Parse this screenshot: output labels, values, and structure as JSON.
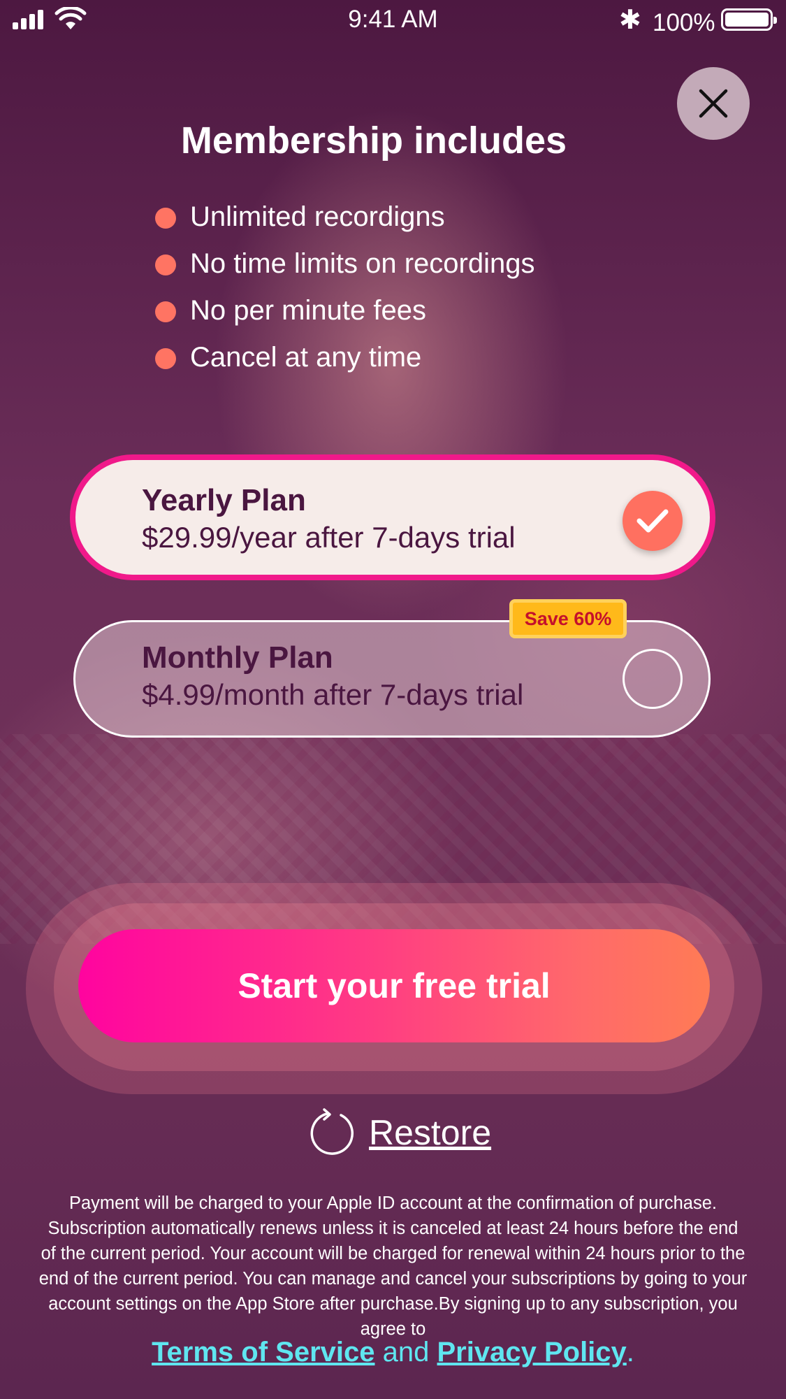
{
  "status_bar": {
    "time": "9:41 AM",
    "battery_pct": "100%"
  },
  "header": {
    "title": "Membership includes"
  },
  "features": [
    "Unlimited recordigns",
    "No time limits on recordings",
    "No per minute fees",
    "Cancel at any time"
  ],
  "plans": {
    "yearly": {
      "name": "Yearly Plan",
      "price": "$29.99/year after 7-days trial",
      "selected": true
    },
    "monthly": {
      "name": "Monthly Plan",
      "price": "$4.99/month after 7-days trial",
      "selected": false,
      "badge": "Save 60%"
    }
  },
  "cta": {
    "label": "Start your free trial"
  },
  "restore": {
    "label": "Restore"
  },
  "legal": {
    "text": "Payment will be charged to your Apple ID account at the confirmation of purchase. Subscription automatically renews unless it is canceled at least 24 hours before the end of the current period. Your account will be charged for renewal within 24 hours prior to the end of the current period. You can manage and cancel your subscriptions by going to your account settings on the App Store after purchase.By signing up to any subscription, you agree to",
    "terms": "Terms of Service",
    "and": "and",
    "privacy": "Privacy Policy",
    "end": "."
  },
  "colors": {
    "accent": "#f0198a",
    "bullet": "#ff7463",
    "link": "#5fe6f0",
    "badge": "#ffb91a"
  }
}
